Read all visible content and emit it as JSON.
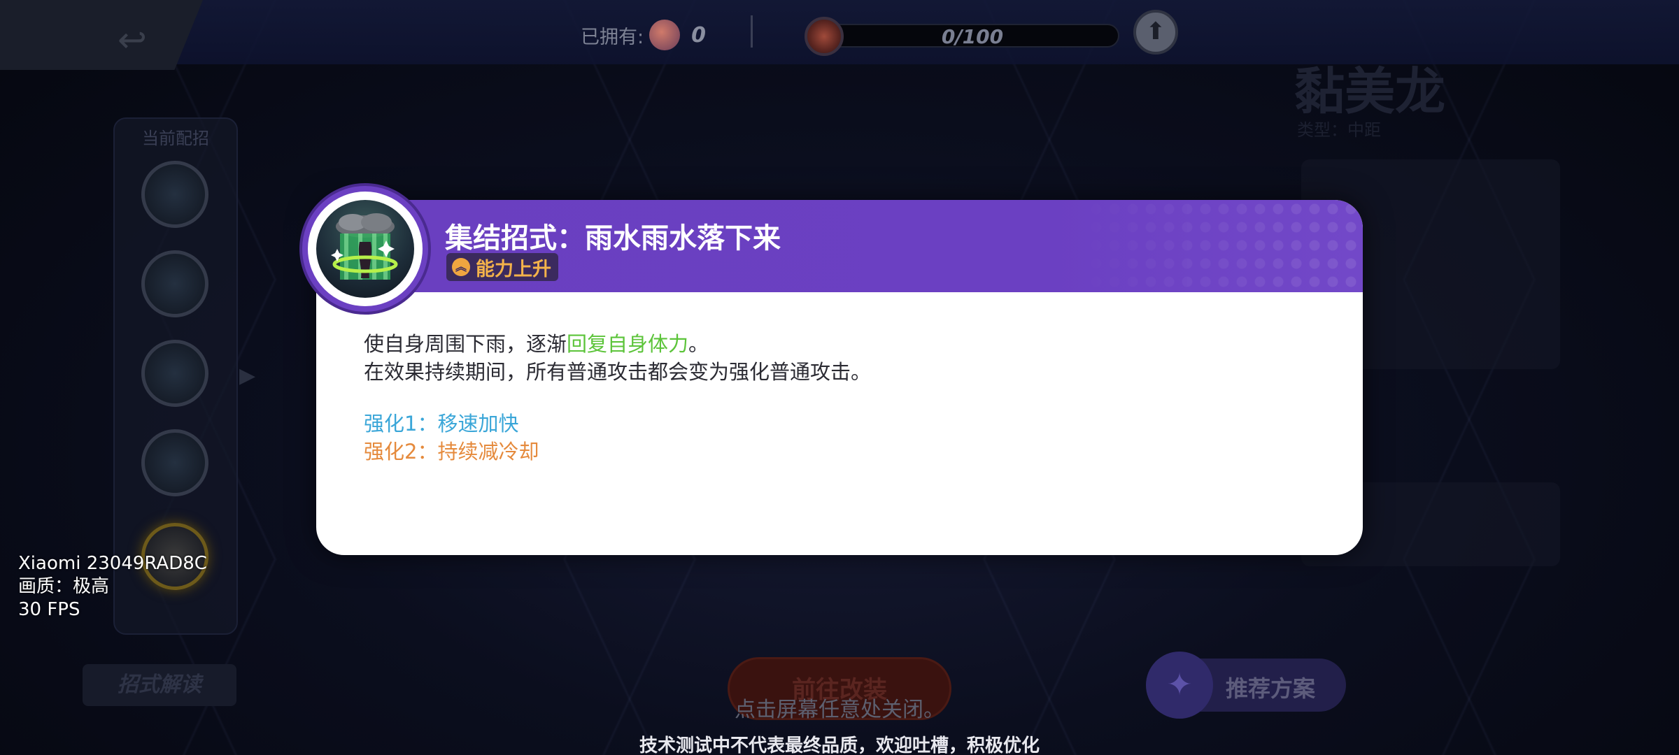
{
  "topbar": {
    "owned_label": "已拥有:",
    "owned_count": "0",
    "progress_text": "0/100",
    "progress_fraction": 0
  },
  "left_panel": {
    "title": "当前配招",
    "bottom_button": "招式解读"
  },
  "center_button": "前往改装",
  "plan_button": "推荐方案",
  "pokemon": {
    "name": "黏美龙",
    "subtitle": "类型：中距"
  },
  "modal": {
    "title": "集结招式：雨水雨水落下来",
    "tag_label": "能力上升",
    "desc_line1_prefix": "使自身周围下雨，逐渐",
    "desc_line1_highlight": "回复自身体力",
    "desc_line1_suffix": "。",
    "desc_line2": "在效果持续期间，所有普通攻击都会变为强化普通攻击。",
    "enhance1": "强化1：移速加快",
    "enhance2": "强化2：持续减冷却",
    "accent_color": "#6b40c2",
    "highlight_color": "#5cc43a",
    "enhance1_color": "#3aa6d8",
    "enhance2_color": "#e58a3c"
  },
  "close_hint": "点击屏幕任意处关闭。",
  "disclaimer": "技术测试中不代表最终品质，欢迎吐槽，积极优化",
  "device_info": {
    "model": "Xiaomi 23049RAD8C",
    "quality": "画质：极高",
    "fps": "30 FPS"
  }
}
